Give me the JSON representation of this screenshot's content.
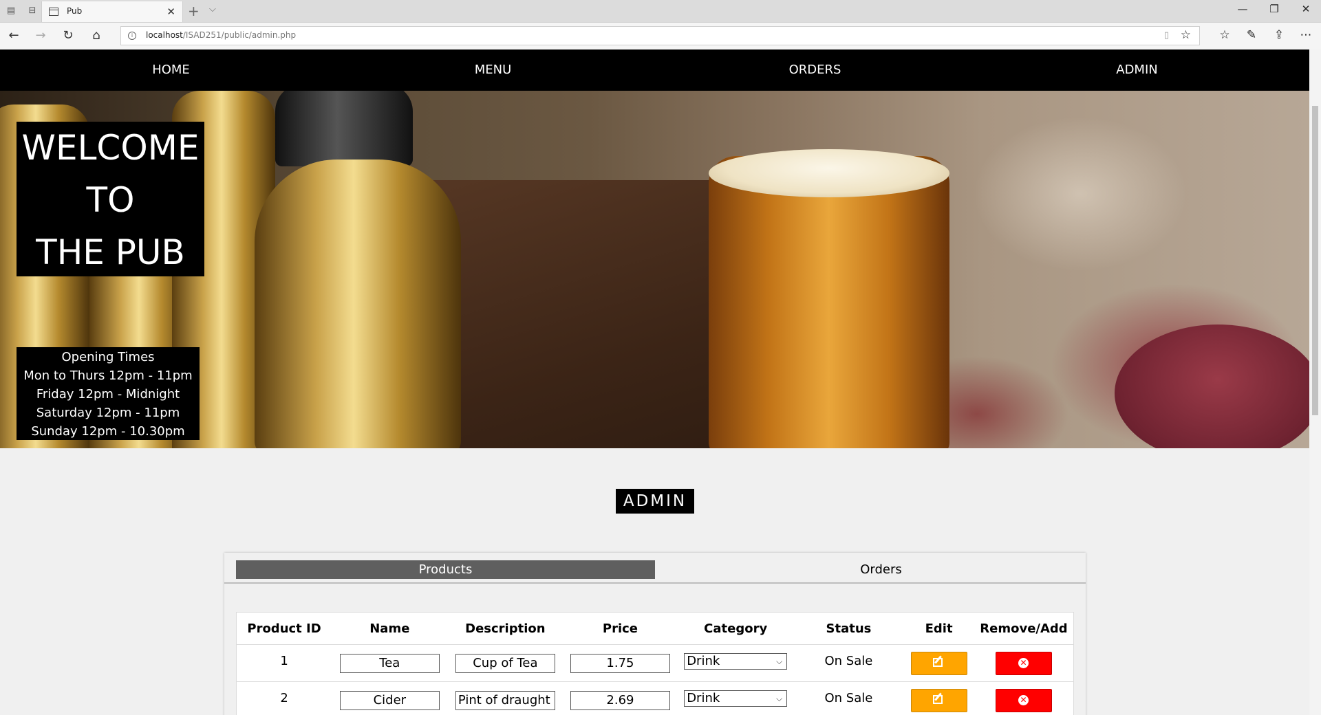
{
  "browser": {
    "tab_title": "Pub",
    "url_host": "localhost",
    "url_path": "/ISAD251/public/admin.php"
  },
  "nav": {
    "items": [
      "HOME",
      "MENU",
      "ORDERS",
      "ADMIN"
    ]
  },
  "hero": {
    "welcome_lines": [
      "WELCOME",
      "TO",
      "THE PUB"
    ],
    "hours_title": "Opening Times",
    "hours": [
      "Mon to Thurs 12pm - 11pm",
      "Friday 12pm - Midnight",
      "Saturday 12pm - 11pm",
      "Sunday 12pm - 10.30pm"
    ]
  },
  "admin": {
    "title": "ADMIN",
    "tabs": [
      "Products",
      "Orders"
    ],
    "active_tab": "Products",
    "columns": [
      "Product ID",
      "Name",
      "Description",
      "Price",
      "Category",
      "Status",
      "Edit",
      "Remove/Add"
    ],
    "rows": [
      {
        "id": "1",
        "name": "Tea",
        "description": "Cup of Tea",
        "price": "1.75",
        "category": "Drink",
        "status": "On Sale"
      },
      {
        "id": "2",
        "name": "Cider",
        "description": "Pint of draught cider",
        "price": "2.69",
        "category": "Drink",
        "status": "On Sale"
      }
    ]
  },
  "colors": {
    "nav_bg": "#000000",
    "active_tab": "#5f5f5f",
    "edit_button": "#ffa500",
    "remove_button": "#ff0000"
  },
  "icons": {
    "edit": "edit-icon",
    "remove": "remove-icon"
  }
}
